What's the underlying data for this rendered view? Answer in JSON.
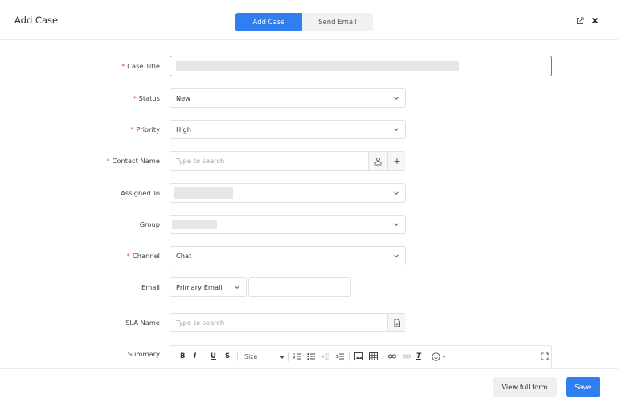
{
  "header": {
    "title": "Add Case",
    "tabs": [
      {
        "label": "Add Case",
        "active": true
      },
      {
        "label": "Send Email",
        "active": false
      }
    ],
    "icons": [
      "external-link-icon",
      "close-icon"
    ]
  },
  "form": {
    "required_mark": "*",
    "case_title": {
      "label": "Case Title",
      "required": true,
      "value": ""
    },
    "status": {
      "label": "Status",
      "required": true,
      "value": "New"
    },
    "priority": {
      "label": "Priority",
      "required": true,
      "value": "High"
    },
    "contact_name": {
      "label": "Contact Name",
      "required": true,
      "placeholder": "Type to search",
      "add_symbol": "+"
    },
    "assigned_to": {
      "label": "Assigned To",
      "required": false,
      "value": ""
    },
    "group": {
      "label": "Group",
      "required": false,
      "value": ""
    },
    "channel": {
      "label": "Channel",
      "required": true,
      "value": "Chat"
    },
    "email": {
      "label": "Email",
      "required": false,
      "type_value": "Primary Email",
      "value": ""
    },
    "sla_name": {
      "label": "SLA Name",
      "required": false,
      "placeholder": "Type to search"
    },
    "summary": {
      "label": "Summary",
      "toolbar": {
        "bold": "B",
        "italic": "I",
        "underline": "U",
        "strike": "S",
        "size": "Size",
        "clear_format": "T"
      }
    }
  },
  "footer": {
    "view_full_form": "View full form",
    "save": "Save"
  },
  "colors": {
    "accent": "#2f7ff0",
    "required": "#ef4a3c",
    "focus_border": "#2f7ff0"
  }
}
